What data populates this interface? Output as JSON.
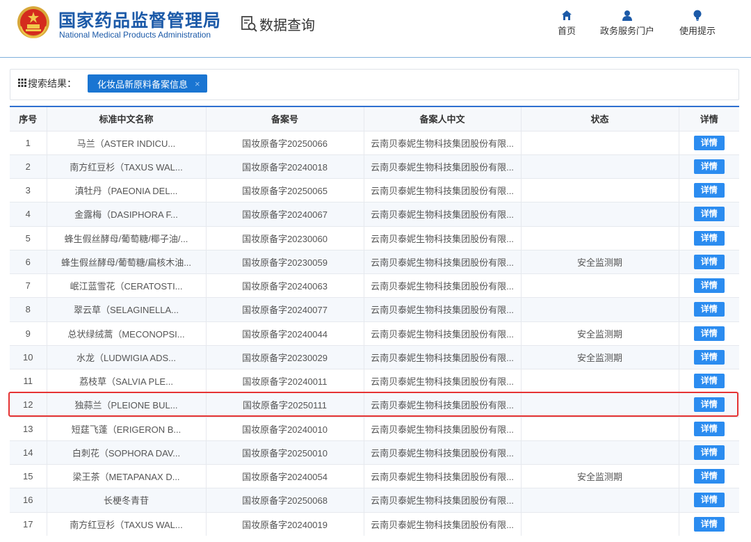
{
  "header": {
    "title_cn": "国家药品监督管理局",
    "title_en": "National Medical Products Administration",
    "query_title": "数据查询",
    "nav": [
      {
        "label": "首页",
        "icon": "home-icon"
      },
      {
        "label": "政务服务门户",
        "icon": "user-icon"
      },
      {
        "label": "使用提示",
        "icon": "lightbulb-icon"
      }
    ]
  },
  "search": {
    "result_label": "搜索结果：",
    "tag_label": "化妆品新原料备案信息",
    "tag_close": "×"
  },
  "table": {
    "columns": [
      "序号",
      "标准中文名称",
      "备案号",
      "备案人中文",
      "状态",
      "详情"
    ],
    "detail_label": "详情",
    "highlighted_row": 12,
    "rows": [
      {
        "no": "1",
        "name": "马兰（ASTER INDICU...",
        "record": "国妆原备字20250066",
        "filer": "云南贝泰妮生物科技集团股份有限...",
        "status": ""
      },
      {
        "no": "2",
        "name": "南方红豆杉（TAXUS WAL...",
        "record": "国妆原备字20240018",
        "filer": "云南贝泰妮生物科技集团股份有限...",
        "status": ""
      },
      {
        "no": "3",
        "name": "滇牡丹（PAEONIA DEL...",
        "record": "国妆原备字20250065",
        "filer": "云南贝泰妮生物科技集团股份有限...",
        "status": ""
      },
      {
        "no": "4",
        "name": "金露梅（DASIPHORA F...",
        "record": "国妆原备字20240067",
        "filer": "云南贝泰妮生物科技集团股份有限...",
        "status": ""
      },
      {
        "no": "5",
        "name": "蜂生假丝酵母/葡萄糖/椰子油/...",
        "record": "国妆原备字20230060",
        "filer": "云南贝泰妮生物科技集团股份有限...",
        "status": ""
      },
      {
        "no": "6",
        "name": "蜂生假丝酵母/葡萄糖/扁核木油...",
        "record": "国妆原备字20230059",
        "filer": "云南贝泰妮生物科技集团股份有限...",
        "status": "安全监测期"
      },
      {
        "no": "7",
        "name": "岷江蓝雪花（CERATOSTI...",
        "record": "国妆原备字20240063",
        "filer": "云南贝泰妮生物科技集团股份有限...",
        "status": ""
      },
      {
        "no": "8",
        "name": "翠云草（SELAGINELLA...",
        "record": "国妆原备字20240077",
        "filer": "云南贝泰妮生物科技集团股份有限...",
        "status": ""
      },
      {
        "no": "9",
        "name": "总状绿绒蒿（MECONOPSI...",
        "record": "国妆原备字20240044",
        "filer": "云南贝泰妮生物科技集团股份有限...",
        "status": "安全监测期"
      },
      {
        "no": "10",
        "name": "水龙（LUDWIGIA ADS...",
        "record": "国妆原备字20230029",
        "filer": "云南贝泰妮生物科技集团股份有限...",
        "status": "安全监测期"
      },
      {
        "no": "11",
        "name": "荔枝草（SALVIA PLE...",
        "record": "国妆原备字20240011",
        "filer": "云南贝泰妮生物科技集团股份有限...",
        "status": ""
      },
      {
        "no": "12",
        "name": "独蒜兰（PLEIONE BUL...",
        "record": "国妆原备字20250111",
        "filer": "云南贝泰妮生物科技集团股份有限...",
        "status": ""
      },
      {
        "no": "13",
        "name": "短莛飞蓬（ERIGERON B...",
        "record": "国妆原备字20240010",
        "filer": "云南贝泰妮生物科技集团股份有限...",
        "status": ""
      },
      {
        "no": "14",
        "name": "白刺花（SOPHORA DAV...",
        "record": "国妆原备字20250010",
        "filer": "云南贝泰妮生物科技集团股份有限...",
        "status": ""
      },
      {
        "no": "15",
        "name": "梁王茶（METAPANAX D...",
        "record": "国妆原备字20240054",
        "filer": "云南贝泰妮生物科技集团股份有限...",
        "status": "安全监测期"
      },
      {
        "no": "16",
        "name": "长梗冬青苷",
        "record": "国妆原备字20250068",
        "filer": "云南贝泰妮生物科技集团股份有限...",
        "status": ""
      },
      {
        "no": "17",
        "name": "南方红豆杉（TAXUS WAL...",
        "record": "国妆原备字20240019",
        "filer": "云南贝泰妮生物科技集团股份有限...",
        "status": ""
      }
    ]
  },
  "colors": {
    "brand": "#1c5aa8",
    "accent": "#1a75d2",
    "button": "#2b8cf0",
    "highlight": "#e53333"
  }
}
